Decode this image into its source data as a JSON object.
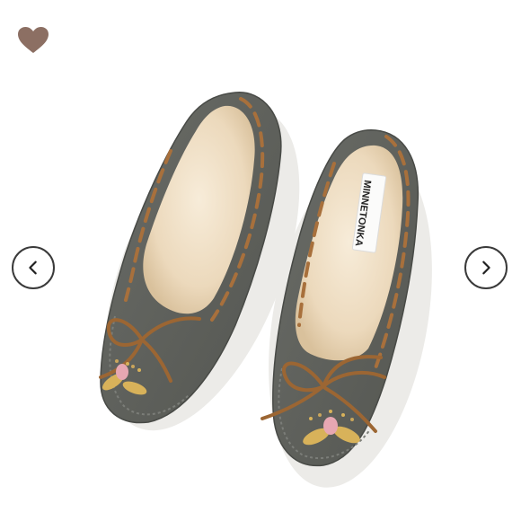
{
  "product": {
    "brand_label": "MINNETONKA"
  },
  "controls": {
    "like_icon": "heart-icon",
    "like_color": "#8c6f63",
    "prev_icon": "chevron-left-icon",
    "next_icon": "chevron-right-icon"
  },
  "colors": {
    "suede": "#5d5f5b",
    "suede_dark": "#4b4d49",
    "fleece": "#efdfc5",
    "lace": "#a8703c",
    "bead_gold": "#d8b25a",
    "bead_pink": "#e7a7b2"
  }
}
